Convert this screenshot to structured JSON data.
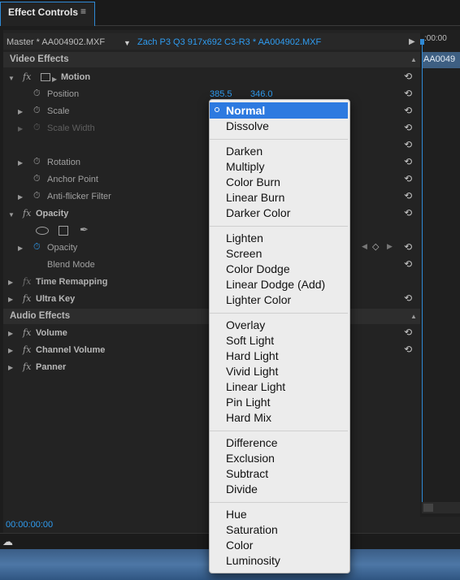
{
  "tab": {
    "label": "Effect Controls",
    "menu_icon": "≡"
  },
  "header": {
    "master": "Master * AA004902.MXF",
    "sequence": "Zach P3 Q3 917x692 C3-R3 * AA004902.MXF"
  },
  "timeline": {
    "time": ":00:00",
    "clip": "AA0049"
  },
  "video_effects": {
    "label": "Video Effects",
    "motion": {
      "label": "Motion",
      "position": {
        "label": "Position",
        "x": "385.5",
        "y": "346.0"
      },
      "scale": "Scale",
      "scale_width": "Scale Width",
      "rotation": "Rotation",
      "anchor_point": "Anchor Point",
      "anti_flicker": "Anti-flicker Filter"
    },
    "opacity": {
      "label": "Opacity",
      "opacity_row": "Opacity",
      "blend_mode": "Blend Mode"
    },
    "time_remapping": "Time Remapping",
    "ultra_key": "Ultra Key"
  },
  "audio_effects": {
    "label": "Audio Effects",
    "volume": "Volume",
    "channel_volume": "Channel Volume",
    "panner": "Panner"
  },
  "fx_icon": "fx",
  "footer": {
    "timecode": "00:00:00:00"
  },
  "blend_modes": {
    "selected": "Normal",
    "groups": [
      [
        "Dissolve"
      ],
      [
        "Darken",
        "Multiply",
        "Color Burn",
        "Linear Burn",
        "Darker Color"
      ],
      [
        "Lighten",
        "Screen",
        "Color Dodge",
        "Linear Dodge (Add)",
        "Lighter Color"
      ],
      [
        "Overlay",
        "Soft Light",
        "Hard Light",
        "Vivid Light",
        "Linear Light",
        "Pin Light",
        "Hard Mix"
      ],
      [
        "Difference",
        "Exclusion",
        "Subtract",
        "Divide"
      ],
      [
        "Hue",
        "Saturation",
        "Color",
        "Luminosity"
      ]
    ]
  },
  "colors": {
    "accent": "#2f9cf0",
    "selection": "#2d7ae0"
  }
}
